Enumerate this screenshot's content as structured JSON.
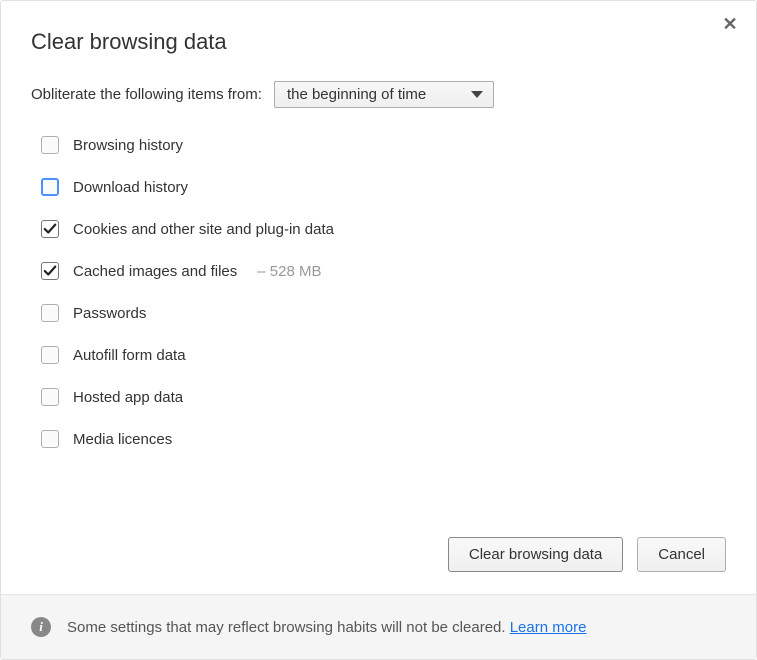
{
  "dialog": {
    "title": "Clear browsing data",
    "from_label": "Obliterate the following items from:",
    "time_range_selected": "the beginning of time"
  },
  "options": [
    {
      "key": "browsing-history",
      "label": "Browsing history",
      "checked": false,
      "focused": false,
      "suffix": ""
    },
    {
      "key": "download-history",
      "label": "Download history",
      "checked": false,
      "focused": true,
      "suffix": ""
    },
    {
      "key": "cookies",
      "label": "Cookies and other site and plug-in data",
      "checked": true,
      "focused": false,
      "suffix": ""
    },
    {
      "key": "cache",
      "label": "Cached images and files",
      "checked": true,
      "focused": false,
      "suffix": "–  528 MB"
    },
    {
      "key": "passwords",
      "label": "Passwords",
      "checked": false,
      "focused": false,
      "suffix": ""
    },
    {
      "key": "autofill",
      "label": "Autofill form data",
      "checked": false,
      "focused": false,
      "suffix": ""
    },
    {
      "key": "hosted-app",
      "label": "Hosted app data",
      "checked": false,
      "focused": false,
      "suffix": ""
    },
    {
      "key": "media-licences",
      "label": "Media licences",
      "checked": false,
      "focused": false,
      "suffix": ""
    }
  ],
  "buttons": {
    "clear": "Clear browsing data",
    "cancel": "Cancel"
  },
  "footer": {
    "text": "Some settings that may reflect browsing habits will not be cleared. ",
    "link": "Learn more"
  }
}
